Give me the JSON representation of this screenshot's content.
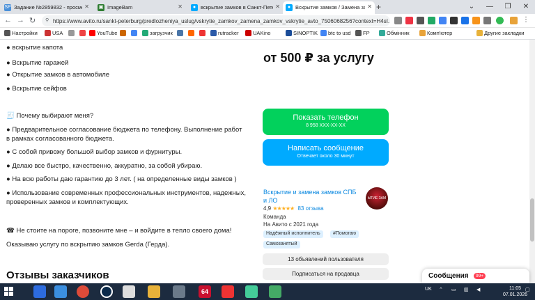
{
  "browser": {
    "tabs": [
      {
        "label": "Задание №2859832 - просмотр з",
        "icon": "SP",
        "icon_color": "#4a90d9",
        "active": false
      },
      {
        "label": "ImageBam",
        "icon": "▣",
        "icon_color": "#2f7d32",
        "active": false
      },
      {
        "label": "вскрытие замков в Санкт-Петерб",
        "icon": "●",
        "icon_color": "#00aaff",
        "active": false
      },
      {
        "label": "Вскрытие замков / Замена замко",
        "icon": "●",
        "icon_color": "#00aaff",
        "active": true
      }
    ],
    "new_tab": "+",
    "window_controls": [
      "⌄",
      "—",
      "❐",
      "✕"
    ],
    "url": "https://www.avito.ru/sankt-peterburg/predlozheniya_uslug/vskrytie_zamkov_zamena_zamkov_vskrytie_avto_7506068256?context=H4sI...",
    "back": "←",
    "forward": "→",
    "reload": "↻",
    "bookmarks": [
      {
        "label": "Настройки",
        "color": "#555"
      },
      {
        "label": "USA",
        "color": "#c33"
      },
      {
        "label": "",
        "color": "#999"
      },
      {
        "label": "",
        "color": "#e44"
      },
      {
        "label": "YouTube",
        "color": "#f00"
      },
      {
        "label": "",
        "color": "#c60"
      },
      {
        "label": "",
        "color": "#4285f4"
      },
      {
        "label": "загрузчик",
        "color": "#2a7"
      },
      {
        "label": "",
        "color": "#4a76a8"
      },
      {
        "label": "",
        "color": "#f60"
      },
      {
        "label": "",
        "color": "#e33"
      },
      {
        "label": "rutracker",
        "color": "#2b5aa8"
      },
      {
        "label": "UAKino",
        "color": "#c00"
      },
      {
        "label": "SINOPTIK",
        "color": "#1b4d99"
      },
      {
        "label": "btc to usd",
        "color": "#4285f4"
      },
      {
        "label": "FP",
        "color": "#555"
      },
      {
        "label": "Обмінник",
        "color": "#3a9"
      },
      {
        "label": "Комп'ютер",
        "color": "#e8a33a"
      },
      {
        "label": "Другие закладки",
        "color": "#e8b23a"
      }
    ]
  },
  "listing": {
    "description_lines": [
      "● вскрытие капота",
      "● Вскрытие гаражей",
      "● Открытие замков в автомобиле",
      "● Вскрытие сейфов",
      "🧾 Почему выбирают меня?",
      "● Предварительное согласование бюджета по телефону. Выполнение работ в рамках согласованного бюджета.",
      "● С собой привожу большой выбор замков и фурнитуры.",
      "● Делаю все быстро, качественно, аккуратно, за собой убираю.",
      "● На всю работы даю гарантию до 3 лет. ( на определенные виды замков )",
      "● Использование современных профессиональных инструментов, надежных, проверенных замков и комплектующих.",
      "☎ Не стоите на пороге, позвоните мне – и войдите в тепло своего дома!",
      "Оказываю услугу по вскрытию замков Gerda (Герда)."
    ],
    "reviews_title": "Отзывы заказчиков",
    "price": "от 500 ₽ за услугу",
    "phone_button": {
      "label": "Показать телефон",
      "sub": "8 958 XXX-XX-XX",
      "color": "#02d15c"
    },
    "message_button": {
      "label": "Написать сообщение",
      "sub": "Отвечает около 30 минут",
      "color": "#00aaff"
    }
  },
  "seller": {
    "name": "Вскрытие и замена замков СПБ и ЛО",
    "rating": "4,9",
    "stars": "★★★★★",
    "reviews": "83 отзыва",
    "type": "Команда",
    "since": "На Авито с 2021 года",
    "avatar_text": "ЫТИЕ ЗАМ",
    "badges": [
      "Надёжный исполнитель",
      "#Помогаю",
      "Самозанятый"
    ],
    "listings_button": "13 объявлений пользователя",
    "subscribe_button": "Подписаться на продавца"
  },
  "messages_panel": {
    "label": "Сообщения",
    "count": "99+"
  },
  "taskbar": {
    "tray_lang": "UK",
    "time": "11:05",
    "date": "07.01.2026"
  }
}
